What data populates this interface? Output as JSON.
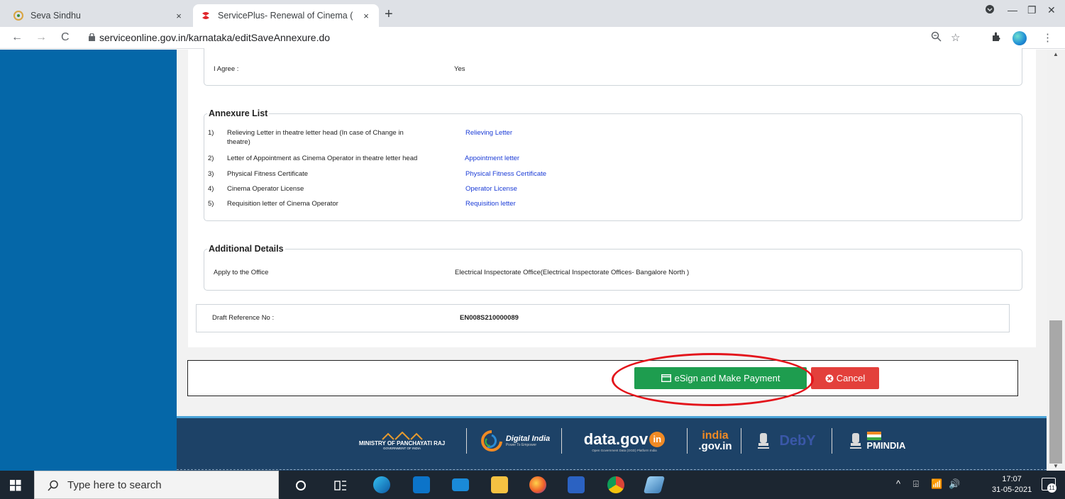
{
  "browser": {
    "tabs": [
      {
        "title": "Seva Sindhu",
        "close": "×",
        "active": false
      },
      {
        "title": "ServicePlus- Renewal of Cinema (",
        "close": "×",
        "active": true
      }
    ],
    "new_tab": "+",
    "url": "serviceonline.gov.in/karnataka/editSaveAnnexure.do",
    "nav": {
      "back": "←",
      "forward": "→",
      "reload": "C"
    },
    "window": {
      "minimize": "—",
      "maximize": "❐",
      "close": "✕"
    }
  },
  "declaration": {
    "label": "I Agree :",
    "value": "Yes"
  },
  "annexure": {
    "legend": "Annexure List",
    "items": [
      {
        "num": "1)",
        "desc_line1": "Relieving Letter in theatre letter head (In case of Change in",
        "desc_line2": "theatre)",
        "link": "Relieving Letter"
      },
      {
        "num": "2)",
        "desc_line1": "Letter of Appointment as Cinema Operator in theatre letter head",
        "desc_line2": "",
        "link": "Appointment letter"
      },
      {
        "num": "3)",
        "desc_line1": "Physical Fitness Certificate",
        "desc_line2": "",
        "link": "Physical Fitness Certificate"
      },
      {
        "num": "4)",
        "desc_line1": "Cinema Operator License",
        "desc_line2": "",
        "link": "Operator License"
      },
      {
        "num": "5)",
        "desc_line1": "Requisition letter of Cinema Operator",
        "desc_line2": "",
        "link": "Requisition letter"
      }
    ]
  },
  "additional": {
    "legend": "Additional Details",
    "label": "Apply to the Office",
    "value": "Electrical Inspectorate Office(Electrical Inspectorate Offices- Bangalore North )"
  },
  "draft": {
    "label": "Draft Reference No :",
    "value": "EN008S210000089"
  },
  "actions": {
    "esign": "eSign and Make Payment",
    "cancel": "Cancel"
  },
  "footer": {
    "logos": {
      "panchayati_line1": "MINISTRY OF PANCHAYATI RAJ",
      "panchayati_line2": "GOVERNMENT OF INDIA",
      "digital_india": "Digital India",
      "digital_india_tagline": "Power To Empower",
      "datagov": "data.gov",
      "datagov_in": "in",
      "datagov_tagline": "Open Government Data (OGD) Platform India",
      "indiagov_top": "india",
      "indiagov_bottom": ".gov.in",
      "digilocker": "DebY",
      "pmindia": "PMINDIA"
    }
  },
  "taskbar": {
    "search_placeholder": "Type here to search",
    "time": "17:07",
    "date": "31-05-2021",
    "notification_count": "11"
  }
}
